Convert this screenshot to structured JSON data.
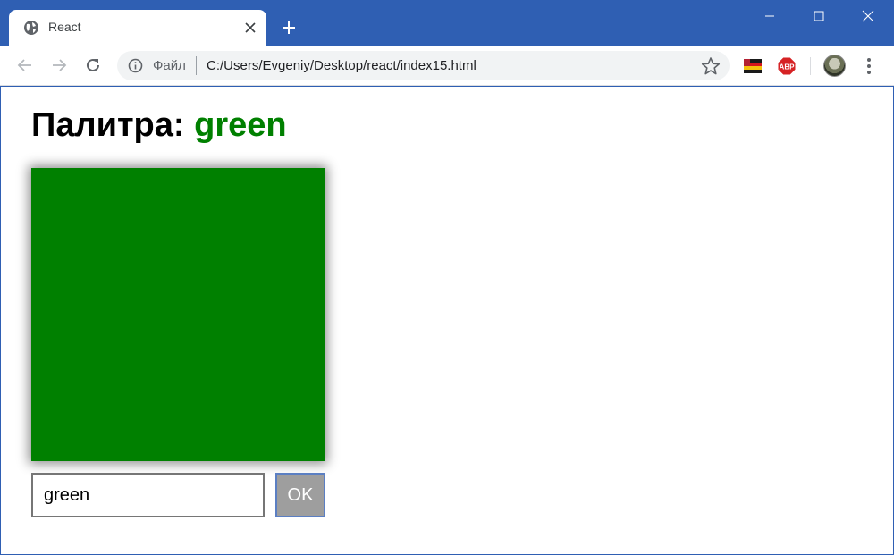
{
  "browser": {
    "tab": {
      "title": "React"
    },
    "omnibox": {
      "security_label": "Файл",
      "url": "C:/Users/Evgeniy/Desktop/react/index15.html"
    },
    "extensions": [
      "flag-extension-icon",
      "adblock-plus-icon"
    ],
    "extension_labels": {
      "adblock": "ABP"
    }
  },
  "page": {
    "heading_prefix": "Палитра: ",
    "heading_color_name": "green",
    "swatch_color": "#008000",
    "input": {
      "value": "green"
    },
    "ok_button": {
      "label": "OK"
    }
  },
  "colors": {
    "titlebar": "#2f5fb3",
    "accent_green": "#008000",
    "button_bg": "#9e9e9e"
  }
}
